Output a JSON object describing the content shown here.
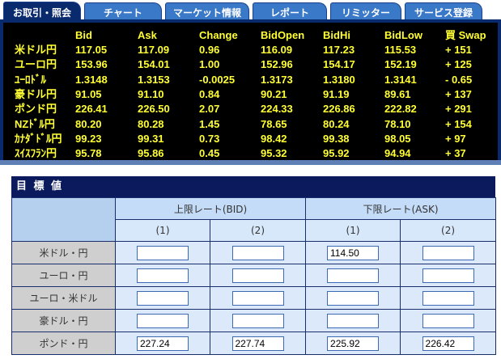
{
  "tabs": [
    {
      "label": "お取引・照会",
      "active": true
    },
    {
      "label": "チャート",
      "active": false
    },
    {
      "label": "マーケット情報",
      "active": false
    },
    {
      "label": "レポート",
      "active": false
    },
    {
      "label": "リミッター",
      "active": false
    },
    {
      "label": "サービス登録",
      "active": false
    }
  ],
  "rates": {
    "headers": [
      "Bid",
      "Ask",
      "Change",
      "BidOpen",
      "BidHi",
      "BidLow",
      "買 Swap"
    ],
    "rows": [
      {
        "name": "米ドル円",
        "bid": "117.05",
        "ask": "117.09",
        "change": "0.96",
        "open": "116.09",
        "hi": "117.23",
        "low": "115.53",
        "swap": "+ 151"
      },
      {
        "name": "ユーロ円",
        "bid": "153.96",
        "ask": "154.01",
        "change": "1.00",
        "open": "152.96",
        "hi": "154.17",
        "low": "152.19",
        "swap": "+ 125"
      },
      {
        "name": "ﾕｰﾛﾄﾞﾙ",
        "bid": "1.3148",
        "ask": "1.3153",
        "change": "-0.0025",
        "open": "1.3173",
        "hi": "1.3180",
        "low": "1.3141",
        "swap": "- 0.65"
      },
      {
        "name": "豪ドル円",
        "bid": "91.05",
        "ask": "91.10",
        "change": "0.84",
        "open": "90.21",
        "hi": "91.19",
        "low": "89.61",
        "swap": "+ 137"
      },
      {
        "name": "ポンド円",
        "bid": "226.41",
        "ask": "226.50",
        "change": "2.07",
        "open": "224.33",
        "hi": "226.86",
        "low": "222.82",
        "swap": "+ 291"
      },
      {
        "name": "NZﾄﾞﾙ円",
        "bid": "80.20",
        "ask": "80.28",
        "change": "1.45",
        "open": "78.65",
        "hi": "80.24",
        "low": "78.10",
        "swap": "+ 154"
      },
      {
        "name": "ｶﾅﾀﾞﾄﾞﾙ円",
        "bid": "99.23",
        "ask": "99.31",
        "change": "0.73",
        "open": "98.42",
        "hi": "99.38",
        "low": "98.05",
        "swap": "+ 97"
      },
      {
        "name": "ｽｲｽﾌﾗﾝ円",
        "bid": "95.78",
        "ask": "95.86",
        "change": "0.45",
        "open": "95.32",
        "hi": "95.92",
        "low": "94.94",
        "swap": "+ 37"
      }
    ]
  },
  "targets": {
    "title": "目 標 値",
    "upper_label": "上限レート(BID)",
    "lower_label": "下限レート(ASK)",
    "sub_labels": [
      "(1)",
      "(2)",
      "(1)",
      "(2)"
    ],
    "rows": [
      {
        "label": "米ドル・円",
        "values": [
          "",
          "",
          "114.50",
          ""
        ]
      },
      {
        "label": "ユーロ・円",
        "values": [
          "",
          "",
          "",
          ""
        ]
      },
      {
        "label": "ユーロ・米ドル",
        "values": [
          "",
          "",
          "",
          ""
        ]
      },
      {
        "label": "豪ドル・円",
        "values": [
          "",
          "",
          "",
          ""
        ]
      },
      {
        "label": "ポンド・円",
        "values": [
          "227.24",
          "227.74",
          "225.92",
          "226.42"
        ]
      }
    ]
  },
  "colors": {
    "board_bg": "#000000",
    "board_text": "#ffff33",
    "tab_bg": "#3a78c8",
    "tab_active": "#0a2a6e",
    "section_head": "#0a1a5c"
  }
}
